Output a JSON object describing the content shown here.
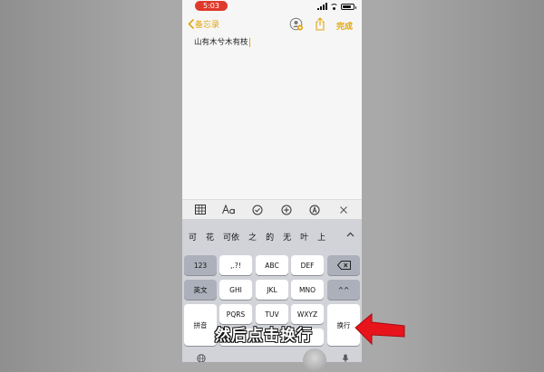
{
  "status": {
    "time": "5:03"
  },
  "nav": {
    "back_label": "备忘录",
    "done_label": "完成"
  },
  "note": {
    "text": "山有木兮木有枝"
  },
  "keyboard": {
    "candidates": [
      "可",
      "花",
      "可依",
      "之",
      "的",
      "无",
      "叶",
      "上"
    ],
    "keys": {
      "num": "123",
      "punct": ",.?!",
      "abc": "ABC",
      "def": "DEF",
      "english": "英文",
      "ghi": "GHI",
      "jkl": "JKL",
      "mno": "MNO",
      "emoji": "^^",
      "pinyin": "拼音",
      "pqrs": "PQRS",
      "tuv": "TUV",
      "wxyz": "WXYZ",
      "newline": "换行"
    }
  },
  "overlay": {
    "caption": "然后点击换行",
    "arrow_color": "#e8141c"
  },
  "colors": {
    "accent": "#e1a70e",
    "status_time_bg": "#e0392b"
  }
}
